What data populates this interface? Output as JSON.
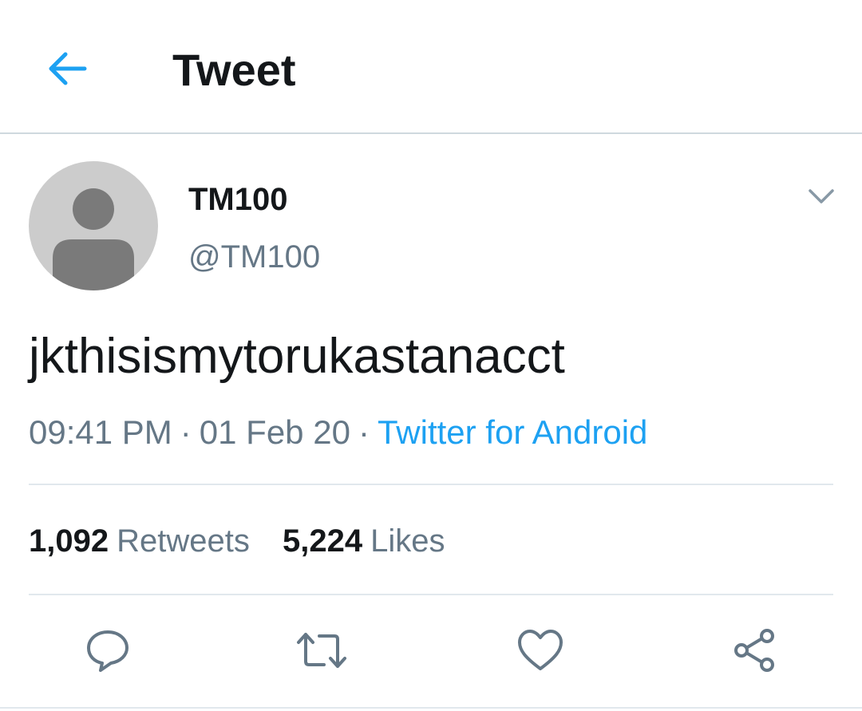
{
  "header": {
    "title": "Tweet",
    "back_icon": "arrow-left-icon"
  },
  "colors": {
    "accent": "#1da1f2",
    "text_primary": "#14171a",
    "text_secondary": "#657786",
    "divider": "#e1e8ed"
  },
  "tweet": {
    "author": {
      "display_name": "TM100",
      "handle": "@TM100",
      "avatar_icon": "default-avatar-icon"
    },
    "text": "jkthisismytorukastanacct",
    "time": "09:41 PM",
    "date": "01 Feb 20",
    "separator": "·",
    "source": "Twitter for Android",
    "menu_icon": "chevron-down-icon"
  },
  "stats": {
    "retweets_count": "1,092",
    "retweets_label": "Retweets",
    "likes_count": "5,224",
    "likes_label": "Likes"
  },
  "actions": [
    {
      "icon": "reply-icon"
    },
    {
      "icon": "retweet-icon"
    },
    {
      "icon": "like-icon"
    },
    {
      "icon": "share-icon"
    }
  ]
}
